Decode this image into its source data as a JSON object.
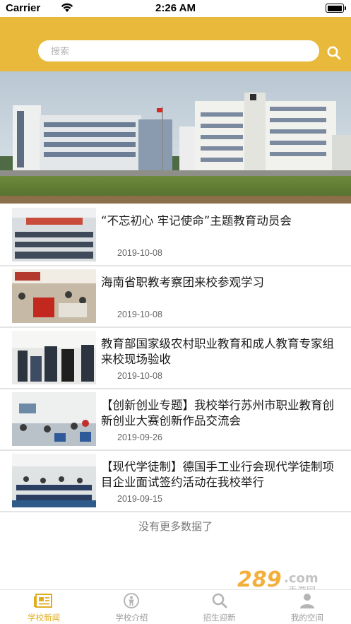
{
  "status_bar": {
    "carrier": "Carrier",
    "time": "2:26 AM",
    "battery_level": 1.0
  },
  "search": {
    "placeholder": "搜索",
    "value": "",
    "icon": "search-icon"
  },
  "colors": {
    "accent": "#e8b93a",
    "tab_active": "#e0ad22",
    "tab_inactive": "#9a9a9a"
  },
  "news": [
    {
      "title": "“不忘初心 牢记使命”主题教育动员会",
      "date": "2019-10-08"
    },
    {
      "title": "海南省职教考察团来校参观学习",
      "date": "2019-10-08"
    },
    {
      "title": "教育部国家级农村职业教育和成人教育专家组来校现场验收",
      "date": "2019-10-08"
    },
    {
      "title": "【创新创业专题】我校举行苏州市职业教育创新创业大赛创新作品交流会",
      "date": "2019-09-26"
    },
    {
      "title": "【现代学徒制】德国手工业行会现代学徒制项目企业面试签约活动在我校举行",
      "date": "2019-09-15"
    }
  ],
  "list_footer": "没有更多数据了",
  "tabs": [
    {
      "label": "学校新闻",
      "icon": "newspaper-icon",
      "active": true
    },
    {
      "label": "学校介绍",
      "icon": "compass-icon",
      "active": false
    },
    {
      "label": "招生迎新",
      "icon": "magnifier-icon",
      "active": false
    },
    {
      "label": "我的空间",
      "icon": "user-icon",
      "active": false
    }
  ],
  "watermark": {
    "text": "289.com",
    "sub_text": "手游网"
  }
}
